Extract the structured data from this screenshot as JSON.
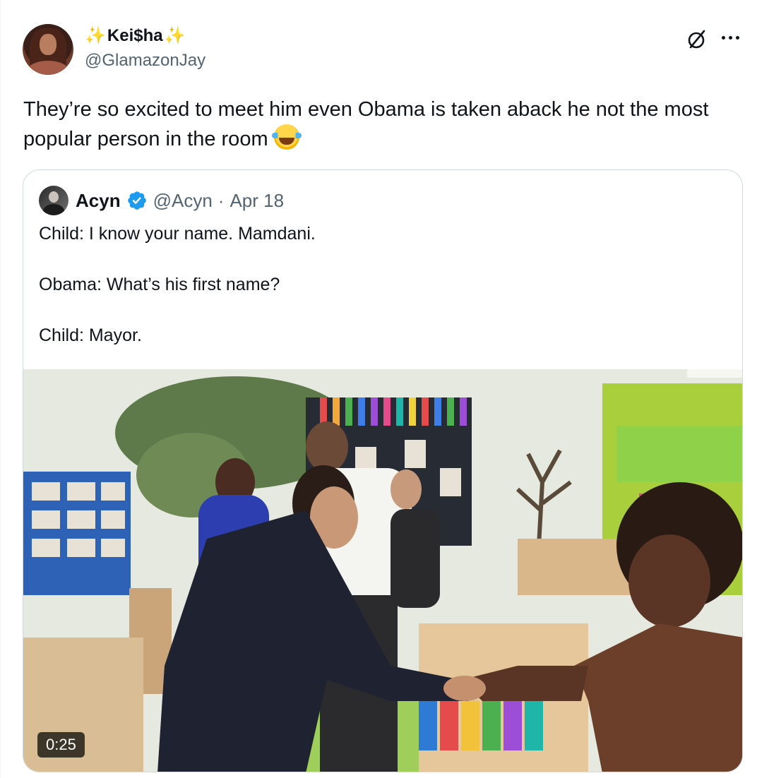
{
  "author": {
    "display_name": "Kei$ha",
    "name_prefix_emoji": "✨",
    "name_suffix_emoji": "✨",
    "handle": "@GlamazonJay"
  },
  "icons": {
    "grok": "grok-icon",
    "more": "more-icon",
    "verified": "verified-badge-icon",
    "emoji": "face-with-tears-of-joy-emoji"
  },
  "tweet": {
    "text": "They’re so excited to meet him even Obama is taken aback he not the most popular person in the room "
  },
  "quoted": {
    "name": "Acyn",
    "handle": "@Acyn",
    "separator": "·",
    "date": "Apr 18",
    "lines": [
      "Child: I know your name. Mamdani.",
      "Obama: What’s his first name?",
      "Child: Mayor."
    ],
    "video": {
      "duration": "0:25"
    }
  },
  "colors": {
    "text_primary": "#0f1419",
    "text_secondary": "#536471",
    "border": "#cfd9de",
    "verified_blue": "#1d9bf0"
  }
}
